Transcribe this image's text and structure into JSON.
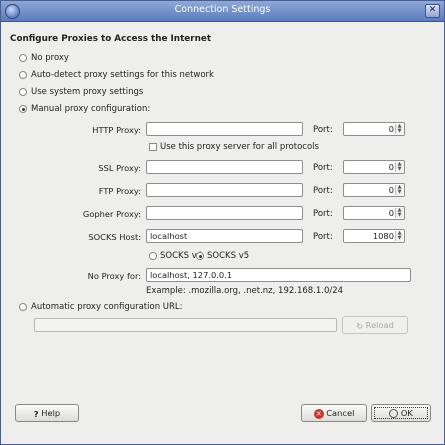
{
  "window": {
    "title": "Connection Settings"
  },
  "heading": "Configure Proxies to Access the Internet",
  "options": {
    "no_proxy": "No proxy",
    "auto_detect": "Auto-detect proxy settings for this network",
    "system": "Use system proxy settings",
    "manual": "Manual proxy configuration:",
    "auto_url": "Automatic proxy configuration URL:"
  },
  "selected_option": "manual",
  "http": {
    "label": "HTTP Proxy:",
    "value": "",
    "port_label": "Port:",
    "port": "0"
  },
  "share_all": "Use this proxy server for all protocols",
  "ssl": {
    "label": "SSL Proxy:",
    "value": "",
    "port_label": "Port:",
    "port": "0"
  },
  "ftp": {
    "label": "FTP Proxy:",
    "value": "",
    "port_label": "Port:",
    "port": "0"
  },
  "gopher": {
    "label": "Gopher Proxy:",
    "value": "",
    "port_label": "Port:",
    "port": "0"
  },
  "socks": {
    "label": "SOCKS Host:",
    "value": "localhost",
    "port_label": "Port:",
    "port": "1080",
    "v4": "SOCKS v4",
    "v5": "SOCKS v5",
    "selected": "v5"
  },
  "no_proxy_for": {
    "label": "No Proxy for:",
    "value": "localhost, 127.0.0.1",
    "example": "Example: .mozilla.org, .net.nz, 192.168.1.0/24"
  },
  "auto_url_value": "",
  "buttons": {
    "reload": "Reload",
    "help": "Help",
    "cancel": "Cancel",
    "ok": "OK"
  },
  "colors": {
    "titlebar": "#5c7bbd",
    "dialog_bg": "#eeeeec"
  }
}
